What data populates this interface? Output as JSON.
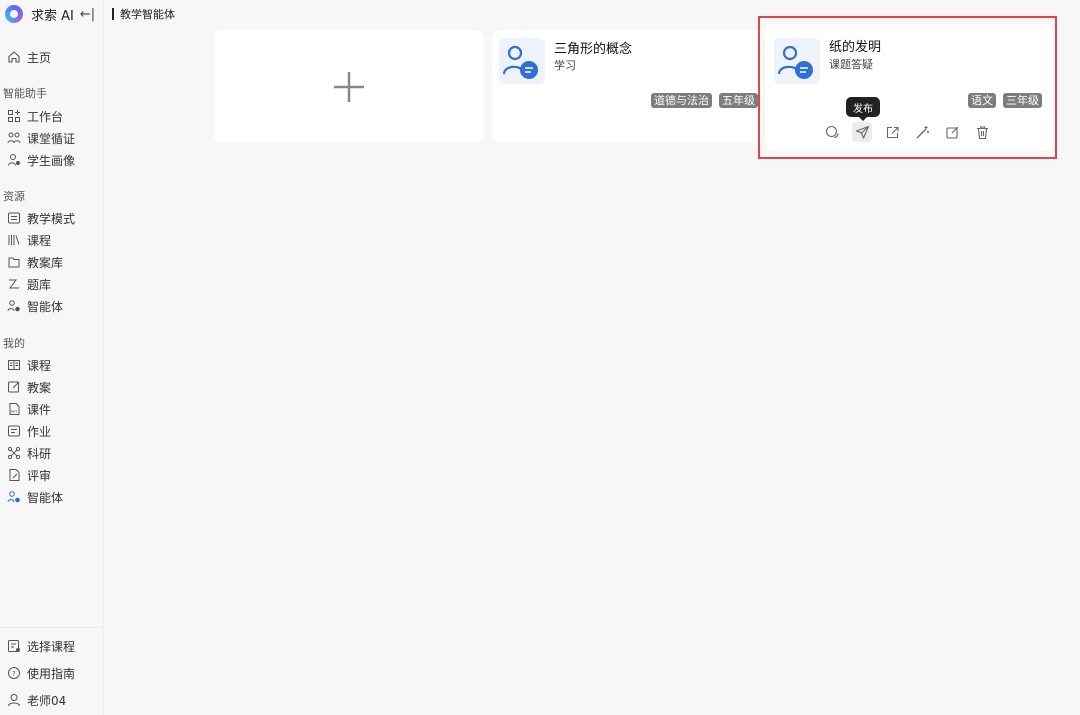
{
  "brand": {
    "name": "求索 AI",
    "collapse_icon": "←|"
  },
  "header": {
    "title": "教学智能体"
  },
  "sidebar": {
    "home": {
      "label": "主页",
      "icon": "home-icon"
    },
    "groups": [
      {
        "title": "智能助手",
        "items": [
          {
            "label": "工作台",
            "icon": "workbench-icon"
          },
          {
            "label": "课堂循证",
            "icon": "classroom-icon"
          },
          {
            "label": "学生画像",
            "icon": "student-portrait-icon"
          }
        ]
      },
      {
        "title": "资源",
        "items": [
          {
            "label": "教学模式",
            "icon": "teaching-mode-icon"
          },
          {
            "label": "课程",
            "icon": "courses-icon"
          },
          {
            "label": "教案库",
            "icon": "lesson-library-icon"
          },
          {
            "label": "题库",
            "icon": "question-bank-icon"
          },
          {
            "label": "智能体",
            "icon": "agent-icon"
          }
        ]
      },
      {
        "title": "我的",
        "items": [
          {
            "label": "课程",
            "icon": "my-course-icon"
          },
          {
            "label": "教案",
            "icon": "my-lesson-icon"
          },
          {
            "label": "课件",
            "icon": "courseware-icon"
          },
          {
            "label": "作业",
            "icon": "homework-icon"
          },
          {
            "label": "科研",
            "icon": "research-icon"
          },
          {
            "label": "评审",
            "icon": "review-icon"
          },
          {
            "label": "智能体",
            "icon": "my-agent-icon"
          }
        ]
      }
    ],
    "bottom": [
      {
        "label": "选择课程",
        "icon": "select-course-icon"
      },
      {
        "label": "使用指南",
        "icon": "help-icon"
      },
      {
        "label": "老师04",
        "icon": "user-icon"
      }
    ]
  },
  "cards": [
    {
      "title": "三角形的概念",
      "subtitle": "学习",
      "tags": [
        "道德与法治",
        "五年级"
      ]
    },
    {
      "title": "纸的发明",
      "subtitle": "课题答疑",
      "tags": [
        "语文",
        "三年级"
      ]
    }
  ],
  "tooltip": "发布",
  "colors": {
    "accent": "#2f6fd6",
    "highlight": "#e0444d",
    "tag_bg": "#7d7d80"
  }
}
